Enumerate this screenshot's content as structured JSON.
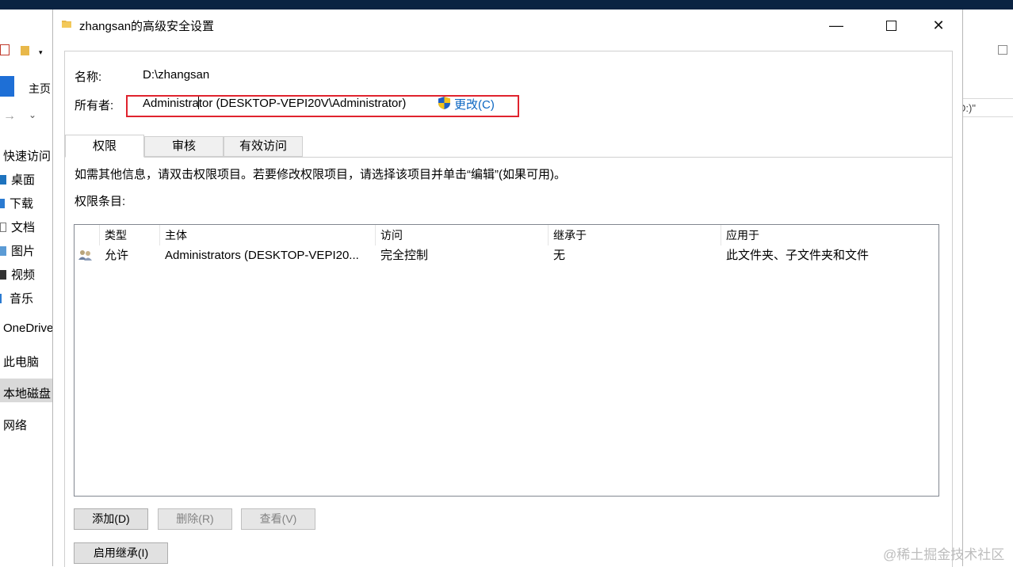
{
  "explorer": {
    "home_tab": "主页",
    "address_fragment": "D:)\"",
    "nav_items": [
      "快速访问",
      "桌面",
      "下载",
      "文档",
      "图片",
      "视频",
      "音乐",
      "OneDrive",
      "此电脑",
      "本地磁盘",
      "网络"
    ]
  },
  "dialog": {
    "title": "zhangsan的高级安全设置",
    "controls": {
      "minimize": "—",
      "maximize": "☐",
      "close": "✕"
    },
    "name_label": "名称:",
    "name_value": "D:\\zhangsan",
    "owner_label": "所有者:",
    "owner_value": "Administrator (DESKTOP-VEPI20V\\Administrator)",
    "change_link": "更改(C)",
    "tabs": [
      "权限",
      "审核",
      "有效访问"
    ],
    "info_text": "如需其他信息，请双击权限项目。若要修改权限项目，请选择该项目并单击“编辑”(如果可用)。",
    "entries_label": "权限条目:",
    "columns": [
      "类型",
      "主体",
      "访问",
      "继承于",
      "应用于"
    ],
    "rows": [
      {
        "type": "允许",
        "principal": "Administrators (DESKTOP-VEPI20...",
        "access": "完全控制",
        "inherited_from": "无",
        "applies_to": "此文件夹、子文件夹和文件"
      }
    ],
    "buttons": {
      "add": "添加(D)",
      "remove": "删除(R)",
      "view": "查看(V)",
      "enable_inheritance": "启用继承(I)"
    }
  },
  "watermark": "@稀土掘金技术社区",
  "colors": {
    "highlight_border": "#e0232e",
    "link": "#0a66c2",
    "accent": "#1e6fd6"
  }
}
